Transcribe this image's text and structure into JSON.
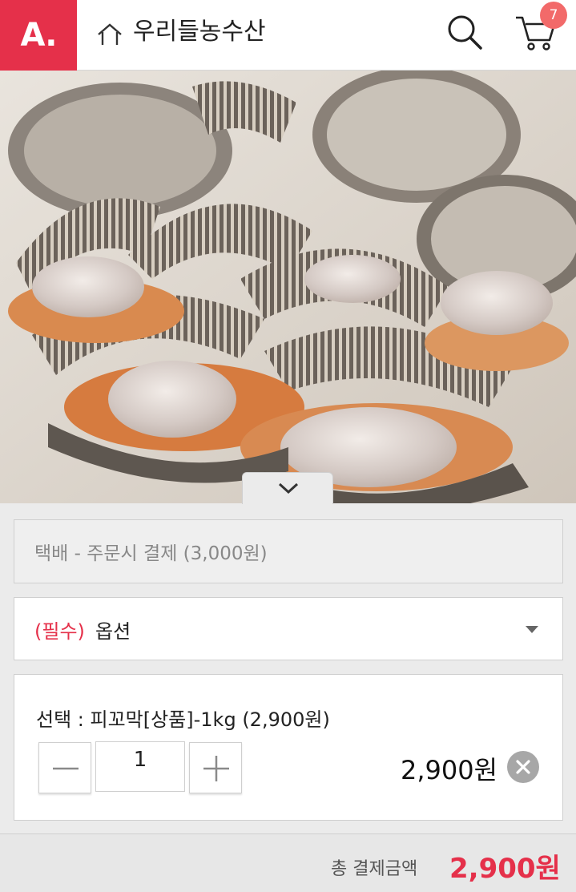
{
  "header": {
    "logo_text": "A.",
    "store_name": "우리들농수산",
    "cart_count": "7",
    "brand_color": "#e5304a"
  },
  "icons": {
    "home": "home-icon",
    "search": "search-icon",
    "cart": "cart-icon",
    "toggle": "chevron-down-icon",
    "remove": "close-icon"
  },
  "product": {
    "image": "product-photo"
  },
  "shipping": {
    "label": "택배 - 주문시 결제 (3,000원)"
  },
  "option": {
    "required_label": "(필수)",
    "label": "옵션"
  },
  "selected_item": {
    "text": "선택 : 피꼬막[상품]-1kg (2,900원)",
    "quantity": "1",
    "price": "2,900원"
  },
  "total": {
    "label": "총 결제금액",
    "value": "2,900원"
  }
}
